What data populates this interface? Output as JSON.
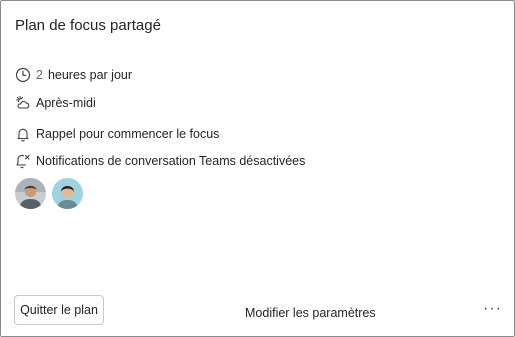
{
  "card": {
    "title": "Plan de focus partagé",
    "items": [
      {
        "icon": "clock-icon",
        "number": "2",
        "label": "heures par jour"
      },
      {
        "icon": "afternoon-weather-icon",
        "label": "Après-midi"
      },
      {
        "icon": "bell-icon",
        "label": "Rappel pour commencer le focus"
      },
      {
        "icon": "chat-notification-off-icon",
        "label": "Notifications de conversation Teams désactivées"
      }
    ],
    "participants": [
      {
        "icon": "participant-avatar"
      },
      {
        "icon": "participant-avatar"
      }
    ]
  },
  "footer": {
    "quit_label": "Quitter le plan",
    "modify_label": "Modifier les paramètres",
    "more_label": "···"
  },
  "colors": {
    "border": "#8a8a8a",
    "text": "#242424",
    "muted": "#616161"
  }
}
